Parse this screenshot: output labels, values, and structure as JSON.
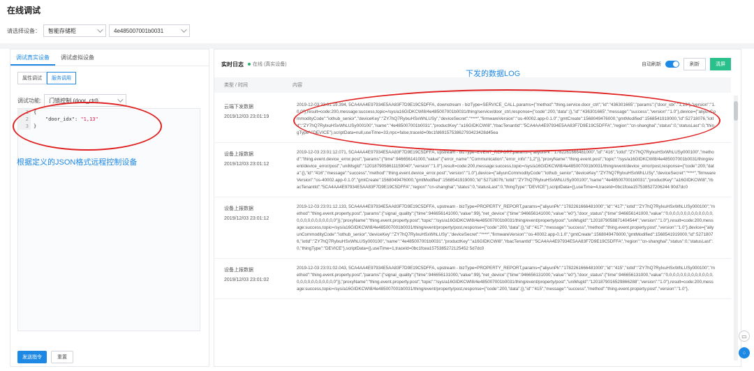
{
  "page": {
    "title": "在线调试"
  },
  "device_select": {
    "label": "请选择设备：",
    "product_value": "智能存储柜",
    "device_value": "4e485007001b0031"
  },
  "left": {
    "tabs": [
      "调试真实设备",
      "调试虚拟设备"
    ],
    "subtabs": [
      "属性调试",
      "服务调用"
    ],
    "function_label": "调试功能:",
    "function_value": "门锁控制 (door_ctrl)",
    "code": {
      "line_numbers": [
        "1",
        "2",
        "3"
      ],
      "line1": "{",
      "line2_key": "    \"door_idx\": ",
      "line2_val": "\"1,13\"",
      "line3": "}"
    },
    "annotation": "根据定义的JSON格式远程控制设备",
    "send_button": "发送指令",
    "reset_button": "重置"
  },
  "right": {
    "title": "实时日志",
    "status": "在线 (真实设备)",
    "annotation": "下发的数据LOG",
    "auto_refresh_label": "自动刷新",
    "refresh_button": "刷新",
    "clear_button": "清屏",
    "col_type": "类型 / 时间",
    "col_content": "内容",
    "rows": [
      {
        "type": "云端下发数据",
        "time": "2019/12/03 23:01:19",
        "content": "2019-12-03 23:01:19.394, 5CA4AA4E97934E5AA83F7D9E19C5DFFA, downstream - bizType=SERVICE_CALL,params={\"method\":\"thing.service.door_ctrl\",\"id\":\"436301665\",\"params\":{\"door_idx\":\"1,13\"},\"version\":\"1.0.0\"},result=code:200,message:success,topic=/sys/a16GIDKCWI8/4e485007001b0031/thing/service/door_ctrl,response={\"code\":200,\"data\":{},\"id\":\"436301665\",\"message\":\"success\",\"version\":\"1.0\"},device={\"aliyunCommodityCode\":\"iothub_senior\",\"deviceKey\":\"ZY7hQ7RylxuHSxWhLUSy\",\"deviceSecret\":\"****\",\"firmwareVersion\":\"os-40002.app-0.1.0\",\"gmtCreate\":1568049476000,\"gmtModified\":1568541919000,\"id\":52718076,\"iotId\":\"ZY7hQ7RylxuHSxWhLUSy000100\",\"name\":\"4e485007001b0031\",\"productKey\":\"a16GIDKCWI8\",\"rbacTenantId\":\"5CA4AA4E97934E5AA83F7D9E19C5DFFA\",\"region\":\"cn-shanghai\",\"status\":0,\"statusLast\":0,\"thingType\":\"DEVICE\"},scriptData=null,useTime=33,rrpc=false,traceId=0bc1fd6915753862793423428d45ea"
      },
      {
        "type": "设备上报数据",
        "time": "2019/12/03 23:01:12",
        "content": "2019-12-03 23:01:12.071, 5CA4AA4E97934E5AA83F7D9E19C5DFFA, upstream - bizType=EVENT_REPORT,params={\"aliyunPk\":\"1782261666481000\",\"id\":\"416\",\"iotId\":\"ZY7hQ7RylxuHSxWhLUSy000100\",\"method\":\"thing.event.device_error.post\",\"params\":{\"time\":946656141000,\"value\":{\"error_name\":\"Communication\",\"error_info\":\"1,2\"}},\"proxyName\":\"thing.event.post\",\"topic\":\"/sys/a16GIDKCWI8/4e485007001b0031/thing/event/device_error/post\",\"uniMsgId\":\"1201879058611159040\",\"version\":\"1.0\"},result=code:200,message:success,topic=/sys/a16GIDKCWI8/4e485007001b0031/thing/event/device_error/post,response={\"code\":200,\"data\":{},\"id\":\"416\",\"message\":\"success\",\"method\":\"thing.event.device_error.post\",\"version\":\"1.0\"},device={\"aliyunCommodityCode\":\"iothub_senior\",\"deviceKey\":\"ZY7hQ7RylxuHSxWhLUSy\",\"deviceSecret\":\"****\",\"firmwareVersion\":\"os-40002.app-0.1.0\",\"gmtCreate\":1568049476000,\"gmtModified\":1568541919000,\"id\":52718076,\"iotId\":\"ZY7hQ7RylxuHSxWhLUSy000100\",\"name\":\"4e485007001b0031\",\"productKey\":\"a16GIDKCWI8\",\"rbacTenantId\":\"5CA4AA4E97934E5AA83F7D9E19C5DFFA\",\"region\":\"cn-shanghai\",\"status\":0,\"statusLast\":0,\"thingType\":\"DEVICE\"},scriptData={},useTime=4,traceId=0bc1fcea157538527206244 90d7dc0"
      },
      {
        "type": "设备上报数据",
        "time": "2019/12/03 23:01:12",
        "content": "2019-12-03 23:01:12.133, 5CA4AA4E97934E5AA83F7D9E19C5DFFA, upstream - bizType=PROPERTY_REPORT,params={\"aliyunPk\":\"1782261666481000\",\"id\":\"417\",\"iotId\":\"ZY7hQ7RylxuHSxWhLUSy000100\",\"method\":\"thing.event.property.post\",\"params\":{\"signal_quality\":{\"time\":946656141000,\"value\":99},\"net_device\":{\"time\":946656141000,\"value\":\"e0\"},\"door_status\":{\"time\":946656141000,\"value\":\"0,0,0,0,0,0,0,0,0,0,0,0,0,0,0,0,0,0,0,0,0,0,0,0\"}},\"proxyName\":\"thing.event.property.post\",\"topic\":\"/sys/a16GIDKCWI8/4e485007001b0031/thing/event/property/post\",\"uniMsgId\":\"1201879058871404544\",\"version\":\"1.0\"},result=code:200,message:success,topic=/sys/a16GIDKCWI8/4e485007001b0031/thing/event/property/post,response={\"code\":200,\"data\":{},\"id\":\"417\",\"message\":\"success\",\"method\":\"thing.event.property.post\",\"version\":\"1.0\"},device={\"aliyunCommodityCode\":\"iothub_senior\",\"deviceKey\":\"ZY7hQ7RylxuHSxWhLUSy\",\"deviceSecret\":\"****\",\"firmwareVersion\":\"os-40002.app-0.1.0\",\"gmtCreate\":1568049476000,\"gmtModified\":1568541919000,\"id\":52718076,\"iotId\":\"ZY7hQ7RylxuHSxWhLUSy000100\",\"name\":\"4e485007001b0031\",\"productKey\":\"a16GIDKCWI8\",\"rbacTenantId\":\"5CA4AA4E97934E5AA83F7D9E19C5DFFA\",\"region\":\"cn-shanghai\",\"status\":0,\"statusLast\":0,\"thingType\":\"DEVICE\"},scriptData={},useTime=1,traceId=0bc1fcea1575385272125452 5d7dc0"
      },
      {
        "type": "设备上报数据",
        "time": "2019/12/03 23:01:02",
        "content": "2019-12-03 23:01:02.043, 5CA4AA4E97934E5AA83F7D9E19C5DFFA, upstream - bizType=PROPERTY_REPORT,params={\"aliyunPk\":\"1782261666481000\",\"id\":\"415\",\"iotId\":\"ZY7hQ7RylxuHSxWhLUSy000100\",\"method\":\"thing.event.property.post\",\"params\":{\"signal_quality\":{\"time\":946656131000,\"value\":99},\"net_device\":{\"time\":946656131000,\"value\":\"e0\"},\"door_status\":{\"time\":946656131000,\"value\":\"0,0,0,0,0,0,0,0,0,0,0,0,0,0,0,0,0,0,0,0,0,0,0,0\"}},\"proxyName\":\"thing.event.property.post\",\"topic\":\"/sys/a16GIDKCWI8/4e485007001b0031/thing/event/property/post\",\"uniMsgId\":\"1201879016529866288\",\"version\":\"1.0\"},result=code:200,message:success,topic=/sys/a16GIDKCWI8/4e485007001b0031/thing/event/property/post,response={\"code\":200,\"data\":{},\"id\":\"415\",\"message\":\"success\",\"method\":\"thing.event.property.post\",\"version\":\"1.0\"},"
      }
    ]
  },
  "colors": {
    "accent": "#1e88e5",
    "clear": "#29c08c",
    "annotation": "#e02020",
    "online": "#29b36b"
  }
}
